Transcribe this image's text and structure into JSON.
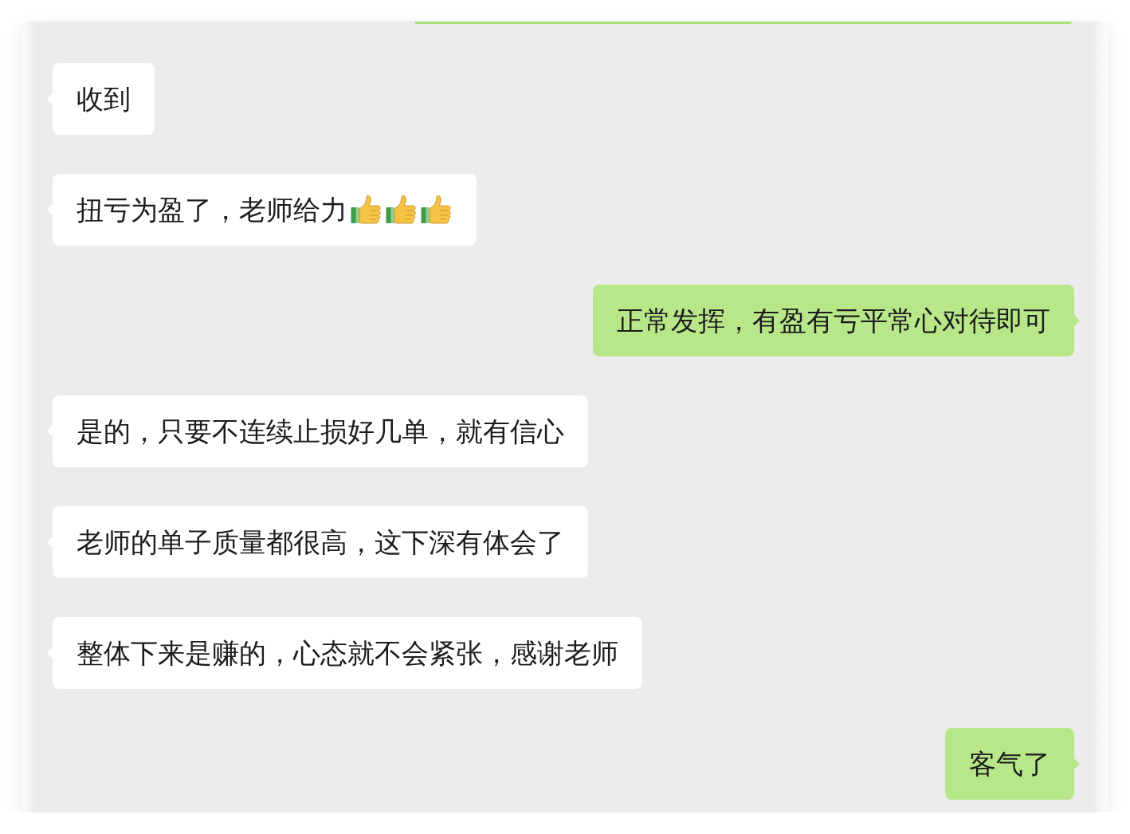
{
  "messages": [
    {
      "outgoing": true,
      "kind": "clipped"
    },
    {
      "outgoing": false,
      "kind": "text",
      "text": "收到"
    },
    {
      "outgoing": false,
      "kind": "text",
      "text": "扭亏为盈了，老师给力",
      "emojis": [
        {
          "kind": "thumbs-up"
        },
        {
          "kind": "thumbs-up"
        },
        {
          "kind": "thumbs-up"
        }
      ]
    },
    {
      "outgoing": true,
      "kind": "text",
      "text": "正常发挥，有盈有亏平常心对待即可"
    },
    {
      "outgoing": false,
      "kind": "text",
      "text": "是的，只要不连续止损好几单，就有信心"
    },
    {
      "outgoing": false,
      "kind": "text",
      "text": "老师的单子质量都很高，这下深有体会了"
    },
    {
      "outgoing": false,
      "kind": "text",
      "text": "整体下来是赚的，心态就不会紧张，感谢老师"
    },
    {
      "outgoing": true,
      "kind": "text",
      "text": "客气了"
    }
  ]
}
